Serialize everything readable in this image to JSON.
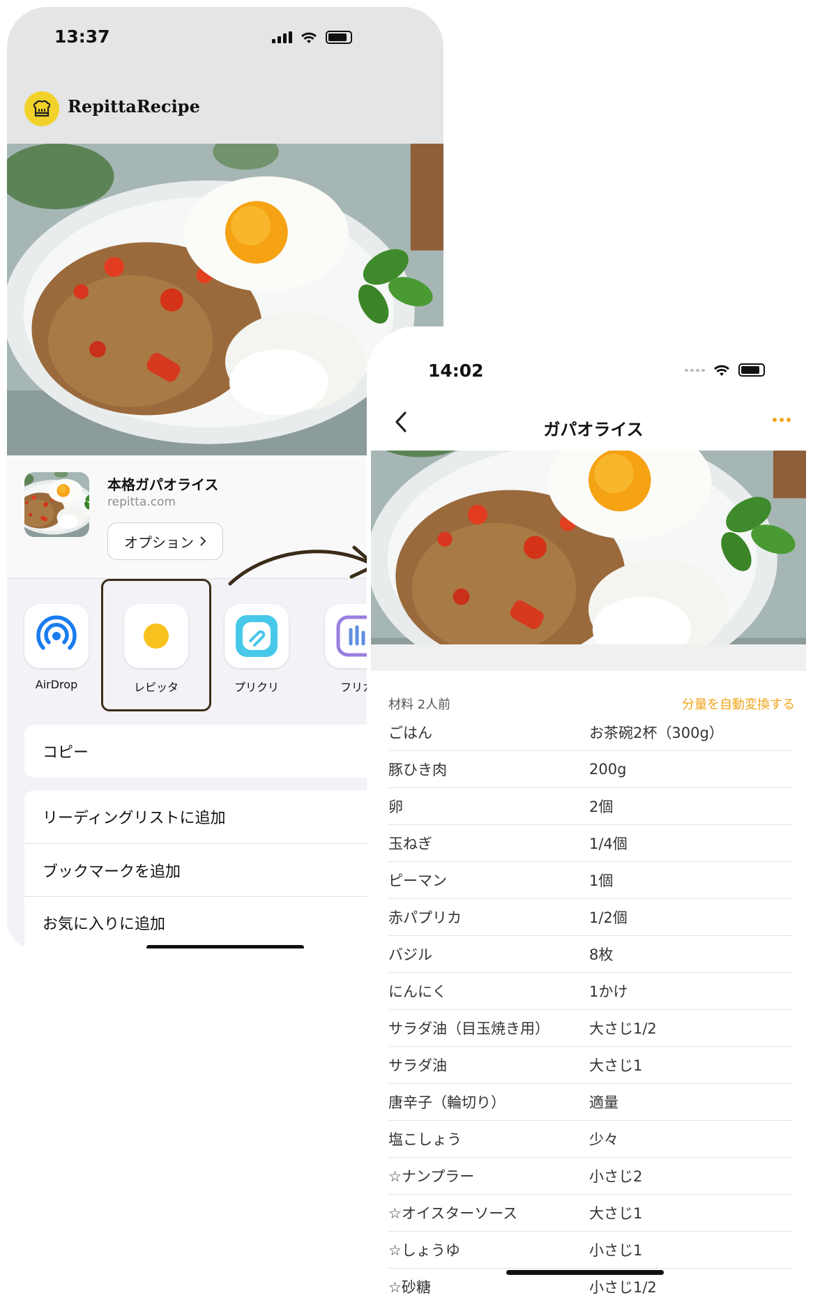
{
  "left_phone": {
    "status_time": "13:37",
    "app_name": "RepittaRecipe",
    "share_sheet": {
      "title": "本格ガパオライス",
      "domain": "repitta.com",
      "options_label": "オプション",
      "apps": [
        {
          "label": "AirDrop",
          "icon": "airdrop-icon"
        },
        {
          "label": "レピッタ",
          "icon": "repitta-icon"
        },
        {
          "label": "プリクリ",
          "icon": "purikuri-icon"
        },
        {
          "label": "フリカ",
          "icon": "furika-icon"
        }
      ],
      "actions": [
        "コピー",
        "リーディングリストに追加",
        "ブックマークを追加",
        "お気に入りに追加"
      ]
    }
  },
  "right_phone": {
    "status_time": "14:02",
    "nav_title": "ガパオライス",
    "ingredients_header": "材料 2人前",
    "auto_convert_label": "分量を自動変換する",
    "ingredients": [
      {
        "name": "ごはん",
        "qty": "お茶碗2杯（300g）"
      },
      {
        "name": "豚ひき肉",
        "qty": "200g"
      },
      {
        "name": "卵",
        "qty": "2個"
      },
      {
        "name": "玉ねぎ",
        "qty": "1/4個"
      },
      {
        "name": "ピーマン",
        "qty": "1個"
      },
      {
        "name": "赤パプリカ",
        "qty": "1/2個"
      },
      {
        "name": "バジル",
        "qty": "8枚"
      },
      {
        "name": "にんにく",
        "qty": "1かけ"
      },
      {
        "name": "サラダ油（目玉焼き用）",
        "qty": "大さじ1/2"
      },
      {
        "name": "サラダ油",
        "qty": "大さじ1"
      },
      {
        "name": "唐辛子（輪切り）",
        "qty": "適量"
      },
      {
        "name": "塩こしょう",
        "qty": "少々"
      },
      {
        "name": "☆ナンプラー",
        "qty": "小さじ2"
      },
      {
        "name": "☆オイスターソース",
        "qty": "大さじ1"
      },
      {
        "name": "☆しょうゆ",
        "qty": "小さじ1"
      },
      {
        "name": "☆砂糖",
        "qty": "小さじ1/2"
      }
    ]
  },
  "colors": {
    "accent": "#f0a51a",
    "logo_yellow": "#f2d22a",
    "highlight_border": "#3a2c18"
  }
}
